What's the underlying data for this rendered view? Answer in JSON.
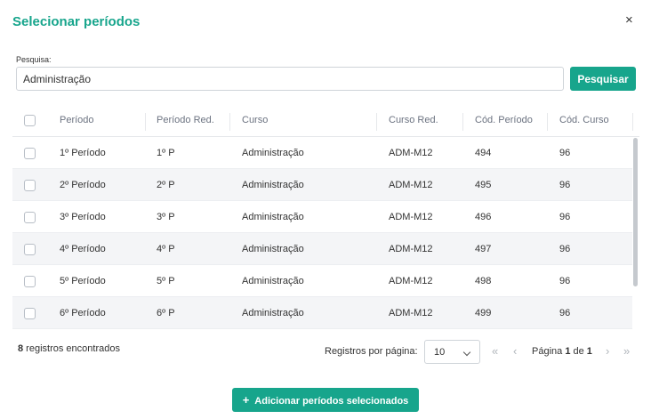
{
  "dialog": {
    "title": "Selecionar períodos",
    "close_glyph": "×"
  },
  "search": {
    "label": "Pesquisa:",
    "value": "Administração",
    "button_label": "Pesquisar"
  },
  "table": {
    "columns": [
      "Período",
      "Período Red.",
      "Curso",
      "Curso Red.",
      "Cód. Período",
      "Cód. Curso"
    ],
    "rows": [
      {
        "periodo": "1º Período",
        "periodo_red": "1º P",
        "curso": "Administração",
        "curso_red": "ADM-M12",
        "cod_periodo": "494",
        "cod_curso": "96"
      },
      {
        "periodo": "2º Período",
        "periodo_red": "2º P",
        "curso": "Administração",
        "curso_red": "ADM-M12",
        "cod_periodo": "495",
        "cod_curso": "96"
      },
      {
        "periodo": "3º Período",
        "periodo_red": "3º P",
        "curso": "Administração",
        "curso_red": "ADM-M12",
        "cod_periodo": "496",
        "cod_curso": "96"
      },
      {
        "periodo": "4º Período",
        "periodo_red": "4º P",
        "curso": "Administração",
        "curso_red": "ADM-M12",
        "cod_periodo": "497",
        "cod_curso": "96"
      },
      {
        "periodo": "5º Período",
        "periodo_red": "5º P",
        "curso": "Administração",
        "curso_red": "ADM-M12",
        "cod_periodo": "498",
        "cod_curso": "96"
      },
      {
        "periodo": "6º Período",
        "periodo_red": "6º P",
        "curso": "Administração",
        "curso_red": "ADM-M12",
        "cod_periodo": "499",
        "cod_curso": "96"
      }
    ]
  },
  "footer": {
    "count": "8",
    "count_suffix": " registros encontrados",
    "rows_per_page_label": "Registros por página:",
    "rows_per_page_value": "10",
    "page_prefix": "Página ",
    "page_current": "1",
    "page_of": " de ",
    "page_total": "1",
    "first_glyph": "«",
    "prev_glyph": "‹",
    "next_glyph": "›",
    "last_glyph": "»"
  },
  "actions": {
    "add_plus": "+",
    "add_label": "Adicionar períodos selecionados"
  },
  "colors": {
    "accent": "#17a58c",
    "row_alt": "#f4f5f7"
  }
}
